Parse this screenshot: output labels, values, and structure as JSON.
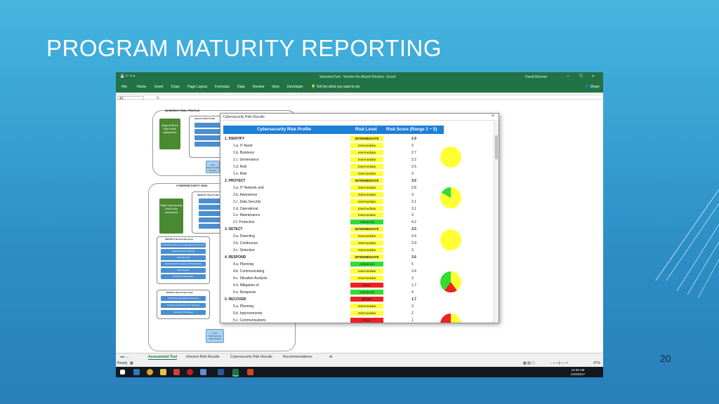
{
  "slide": {
    "title": "PROGRAM MATURITY REPORTING",
    "page_number": "20"
  },
  "excel": {
    "window_title": "SelectiveTool - Version for Airport Review - Excel",
    "user": "David Monroe",
    "ribbon_tabs": [
      "File",
      "Home",
      "Insert",
      "Draw",
      "Page Layout",
      "Formulas",
      "Data",
      "Review",
      "View",
      "Developer",
      "Tell me what you want to do"
    ],
    "share_label": "Share",
    "name_box": "A1",
    "fx_label": "fx",
    "sheet_tabs": [
      "Assessment Tool",
      "Inherent Risk Results",
      "Cybersecurity Risk Results",
      "Recommendations"
    ],
    "active_tab": "Assessment Tool",
    "status": "Ready",
    "zoom": "47%",
    "clock_time": "11:39 AM",
    "clock_date": "2/16/2017"
  },
  "background_sheet": {
    "inherent_title": "INHERENT RISK PROFILE",
    "inherent_button": "Begin Inherent Risk Profile assessment",
    "inherent_inputs_title": "Inherent Risk Profile",
    "cyber_title": "CYBERSECURITY RISK",
    "cyber_button": "Begin Cybersecurity Risk Profile assessment",
    "identify_title": "IDENTIFY Risk Profile",
    "protect_title": "PROTECT Risk Profile Input",
    "detect_title": "DETECT Risk Profile Input",
    "protect_items": [
      "IT Network and Access Management Security",
      "Awareness and Training",
      "Data Security",
      "Operational Processes and Procedures",
      "Maintenance",
      "Protective Technology"
    ],
    "detect_items": [
      "Detecting Anomalies and Events",
      "Continuous Monitoring for Security",
      "Detection Processes"
    ],
    "view_inherent": "View Inherent Risk Results",
    "view_cyber": "View Cybersecurity Risk Results"
  },
  "dialog": {
    "title": "Cybersecurity Risk Results",
    "close_label": "×",
    "header": {
      "profile": "Cybersecurity Risk Profile",
      "level": "Risk Level",
      "score": "Risk Score (Range 1 ~ 5)"
    },
    "rows": [
      {
        "label": "1. IDENTIFY",
        "level": "INTERMEDIATE",
        "score": "2.9",
        "cat": true,
        "color": "#ffff33"
      },
      {
        "label": "1.a. IT Asset",
        "level": "Intermediate",
        "score": "3",
        "cat": false,
        "color": "#ffff33"
      },
      {
        "label": "1.b. Business",
        "level": "Intermediate",
        "score": "2.7",
        "cat": false,
        "color": "#ffff33"
      },
      {
        "label": "1.c. Governance",
        "level": "Intermediate",
        "score": "2.2",
        "cat": false,
        "color": "#ffff33"
      },
      {
        "label": "1.d. Risk",
        "level": "Intermediate",
        "score": "2.5",
        "cat": false,
        "color": "#ffff33"
      },
      {
        "label": "1.e. Risk",
        "level": "Intermediate",
        "score": "3",
        "cat": false,
        "color": "#ffff33"
      },
      {
        "label": "2. PROTECT",
        "level": "INTERMEDIATE",
        "score": "3.6",
        "cat": true,
        "color": "#ffff33"
      },
      {
        "label": "2.a. IT Network and",
        "level": "Intermediate",
        "score": "2.8",
        "cat": false,
        "color": "#ffff33"
      },
      {
        "label": "2.b. Awareness",
        "level": "Intermediate",
        "score": "3",
        "cat": false,
        "color": "#ffff33"
      },
      {
        "label": "2.c. Data Security",
        "level": "Intermediate",
        "score": "2.1",
        "cat": false,
        "color": "#ffff33"
      },
      {
        "label": "2.d. Operational",
        "level": "Intermediate",
        "score": "3.1",
        "cat": false,
        "color": "#ffff33"
      },
      {
        "label": "2.e. Maintenance",
        "level": "Intermediate",
        "score": "3",
        "cat": false,
        "color": "#ffff33"
      },
      {
        "label": "2.f. Protective",
        "level": "Advanced",
        "score": "4.2",
        "cat": false,
        "color": "#33dd33"
      },
      {
        "label": "3. DETECT",
        "level": "INTERMEDIATE",
        "score": "3.5",
        "cat": true,
        "color": "#ffff33"
      },
      {
        "label": "3.a. Detecting",
        "level": "Intermediate",
        "score": "3.4",
        "cat": false,
        "color": "#ffff33"
      },
      {
        "label": "3.b. Continuous",
        "level": "Intermediate",
        "score": "2.9",
        "cat": false,
        "color": "#ffff33"
      },
      {
        "label": "3.c. Detection",
        "level": "Intermediate",
        "score": "3",
        "cat": false,
        "color": "#ffff33"
      },
      {
        "label": "4. RESPOND",
        "level": "INTERMEDIATE",
        "score": "3.6",
        "cat": true,
        "color": "#ffff33"
      },
      {
        "label": "4.a. Planning",
        "level": "Advanced",
        "score": "5",
        "cat": false,
        "color": "#33dd33"
      },
      {
        "label": "4.b. Communicating",
        "level": "Intermediate",
        "score": "3.4",
        "cat": false,
        "color": "#ffff33"
      },
      {
        "label": "4.c. Situation Analysis",
        "level": "Intermediate",
        "score": "3",
        "cat": false,
        "color": "#ffff33"
      },
      {
        "label": "4.d. Mitigation of",
        "level": "Basic",
        "score": "1.7",
        "cat": false,
        "color": "#ee2222"
      },
      {
        "label": "4.e. Response",
        "level": "Advanced",
        "score": "4",
        "cat": false,
        "color": "#33dd33"
      },
      {
        "label": "5. RECOVER",
        "level": "BASIC",
        "score": "1.7",
        "cat": true,
        "color": "#ee2222"
      },
      {
        "label": "5.a. Planning",
        "level": "Intermediate",
        "score": "3",
        "cat": false,
        "color": "#ffff33"
      },
      {
        "label": "5.b. Improvements",
        "level": "Intermediate",
        "score": "2",
        "cat": false,
        "color": "#ffff33"
      },
      {
        "label": "5.c. Communications",
        "level": "Basic",
        "score": "1",
        "cat": false,
        "color": "#ee2222"
      }
    ],
    "pies": [
      {
        "name": "identify-pie",
        "slices": [
          {
            "color": "#ffff33",
            "fraction": 1.0
          }
        ]
      },
      {
        "name": "protect-pie",
        "slices": [
          {
            "color": "#ffff33",
            "fraction": 0.83
          },
          {
            "color": "#33dd33",
            "fraction": 0.17
          }
        ]
      },
      {
        "name": "detect-pie",
        "slices": [
          {
            "color": "#ffff33",
            "fraction": 1.0
          }
        ]
      },
      {
        "name": "respond-pie",
        "slices": [
          {
            "color": "#ffff33",
            "fraction": 0.4
          },
          {
            "color": "#ee2222",
            "fraction": 0.2
          },
          {
            "color": "#33dd33",
            "fraction": 0.4
          }
        ]
      },
      {
        "name": "recover-pie",
        "slices": [
          {
            "color": "#ffff33",
            "fraction": 0.67
          },
          {
            "color": "#ee2222",
            "fraction": 0.33
          }
        ]
      }
    ]
  }
}
